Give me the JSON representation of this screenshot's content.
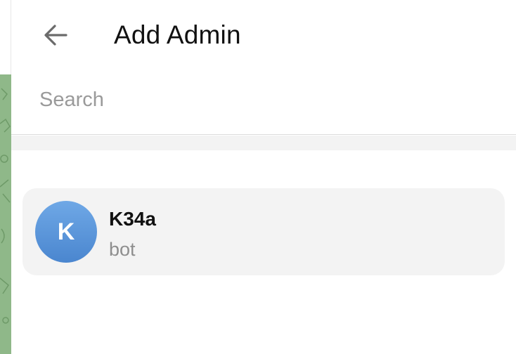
{
  "header": {
    "title": "Add Admin",
    "back_icon": "arrow-left-icon"
  },
  "search": {
    "placeholder": "Search",
    "value": ""
  },
  "members": [
    {
      "avatar_letter": "K",
      "name": "K34a",
      "subtitle": "bot",
      "avatar_color": "#5b97da"
    }
  ],
  "colors": {
    "panel_bg": "#ffffff",
    "list_item_bg": "#f3f3f3",
    "chat_bg": "#8fb889",
    "accent_avatar": "#4a86cf"
  }
}
